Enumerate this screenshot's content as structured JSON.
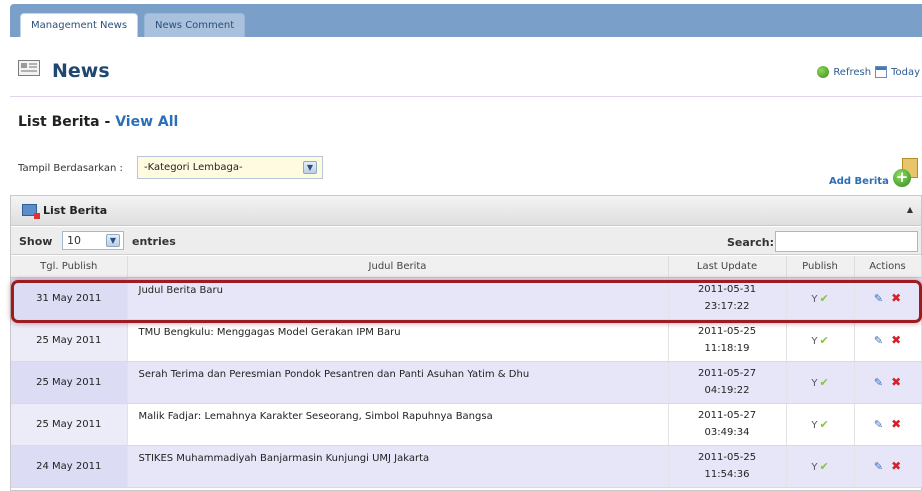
{
  "tabs": [
    {
      "label": "Management News",
      "active": true
    },
    {
      "label": "News Comment",
      "active": false
    }
  ],
  "header": {
    "title": "News",
    "icon": "news-icon",
    "refresh_label": "Refresh",
    "today_label": "Today"
  },
  "section": {
    "title": "List Berita - ",
    "view_all": "View All"
  },
  "filter": {
    "label": "Tampil Berdasarkan :",
    "selected": "-Kategori Lembaga-"
  },
  "add_label": "Add Berita",
  "panel": {
    "title": "List Berita",
    "show_label": "Show",
    "length_value": "10",
    "entries_label": "entries",
    "search_label": "Search:"
  },
  "table": {
    "columns": [
      "Tgl. Publish",
      "Judul Berita",
      "Last Update",
      "Publish",
      "Actions"
    ],
    "rows": [
      {
        "tgl": "31 May 2011",
        "judul": "Judul Berita Baru",
        "upd_date": "2011-05-31",
        "upd_time": "23:17:22",
        "publish": "Y",
        "highlighted": true
      },
      {
        "tgl": "25 May 2011",
        "judul": "TMU Bengkulu: Menggagas Model Gerakan IPM Baru",
        "upd_date": "2011-05-25",
        "upd_time": "11:18:19",
        "publish": "Y"
      },
      {
        "tgl": "25 May 2011",
        "judul": "Serah Terima dan Peresmian Pondok Pesantren dan Panti Asuhan Yatim & Dhu",
        "upd_date": "2011-05-27",
        "upd_time": "04:19:22",
        "publish": "Y"
      },
      {
        "tgl": "25 May 2011",
        "judul": "Malik Fadjar: Lemahnya Karakter Seseorang, Simbol Rapuhnya Bangsa",
        "upd_date": "2011-05-27",
        "upd_time": "03:49:34",
        "publish": "Y"
      },
      {
        "tgl": "24 May 2011",
        "judul": "STIKES Muhammadiyah Banjarmasin Kunjungi UMJ Jakarta",
        "upd_date": "2011-05-25",
        "upd_time": "11:54:36",
        "publish": "Y"
      }
    ]
  },
  "colors": {
    "tab_bar": "#7aa0c9",
    "title": "#1f4770",
    "link": "#2b6fb8",
    "highlight_border": "#9c1c22",
    "row_odd": "#e6e6f8",
    "publish_check": "#88c43d",
    "delete": "#d2222e"
  }
}
